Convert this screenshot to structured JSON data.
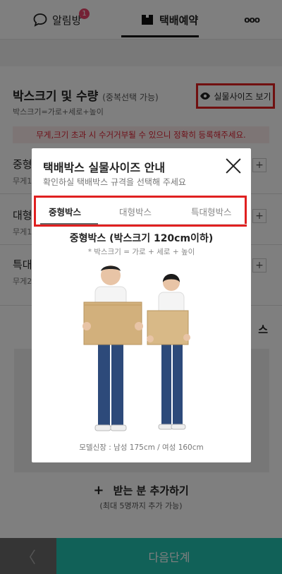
{
  "nav": {
    "alarm_label": "알림방",
    "alarm_count": "1",
    "delivery_label": "택배예약",
    "more_label": "ooo"
  },
  "section": {
    "title": "박스크기 및 수량",
    "title_note": "(중복선택 가능)",
    "subtitle": "박스크기=가로+세로+높이",
    "realsize_button": "실물사이즈 보기",
    "warning": "무게,크기 초과 시 수거거부될 수 있으니 정확히 등록해주세요.",
    "rows": [
      {
        "label": "중형",
        "sub": "무게1"
      },
      {
        "label": "대형",
        "sub": "무게1"
      },
      {
        "label": "특대",
        "sub": "무게2"
      }
    ],
    "right_label": "스",
    "add_recipient": "받는 분 추가하기",
    "add_recipient_note": "(최대 5명까지 추가 가능)"
  },
  "bottom": {
    "back_label": "〈",
    "next_label": "다음단계"
  },
  "modal": {
    "title": "택배박스 실물사이즈 안내",
    "subtitle": "확인하실 택배박스 규격을 선택해 주세요",
    "tabs": [
      "중형박스",
      "대형박스",
      "특대형박스"
    ],
    "active_tab": "중형박스",
    "size_title": "중형박스 (박스크기 120cm이하)",
    "size_note": "* 박스크기 = 가로 + 세로 + 높이",
    "model_info": "모델신장 : 남성 175cm / 여성 160cm"
  },
  "colors": {
    "accent": "#22c3b0",
    "highlight": "#e02020",
    "badge": "#e8446a"
  }
}
